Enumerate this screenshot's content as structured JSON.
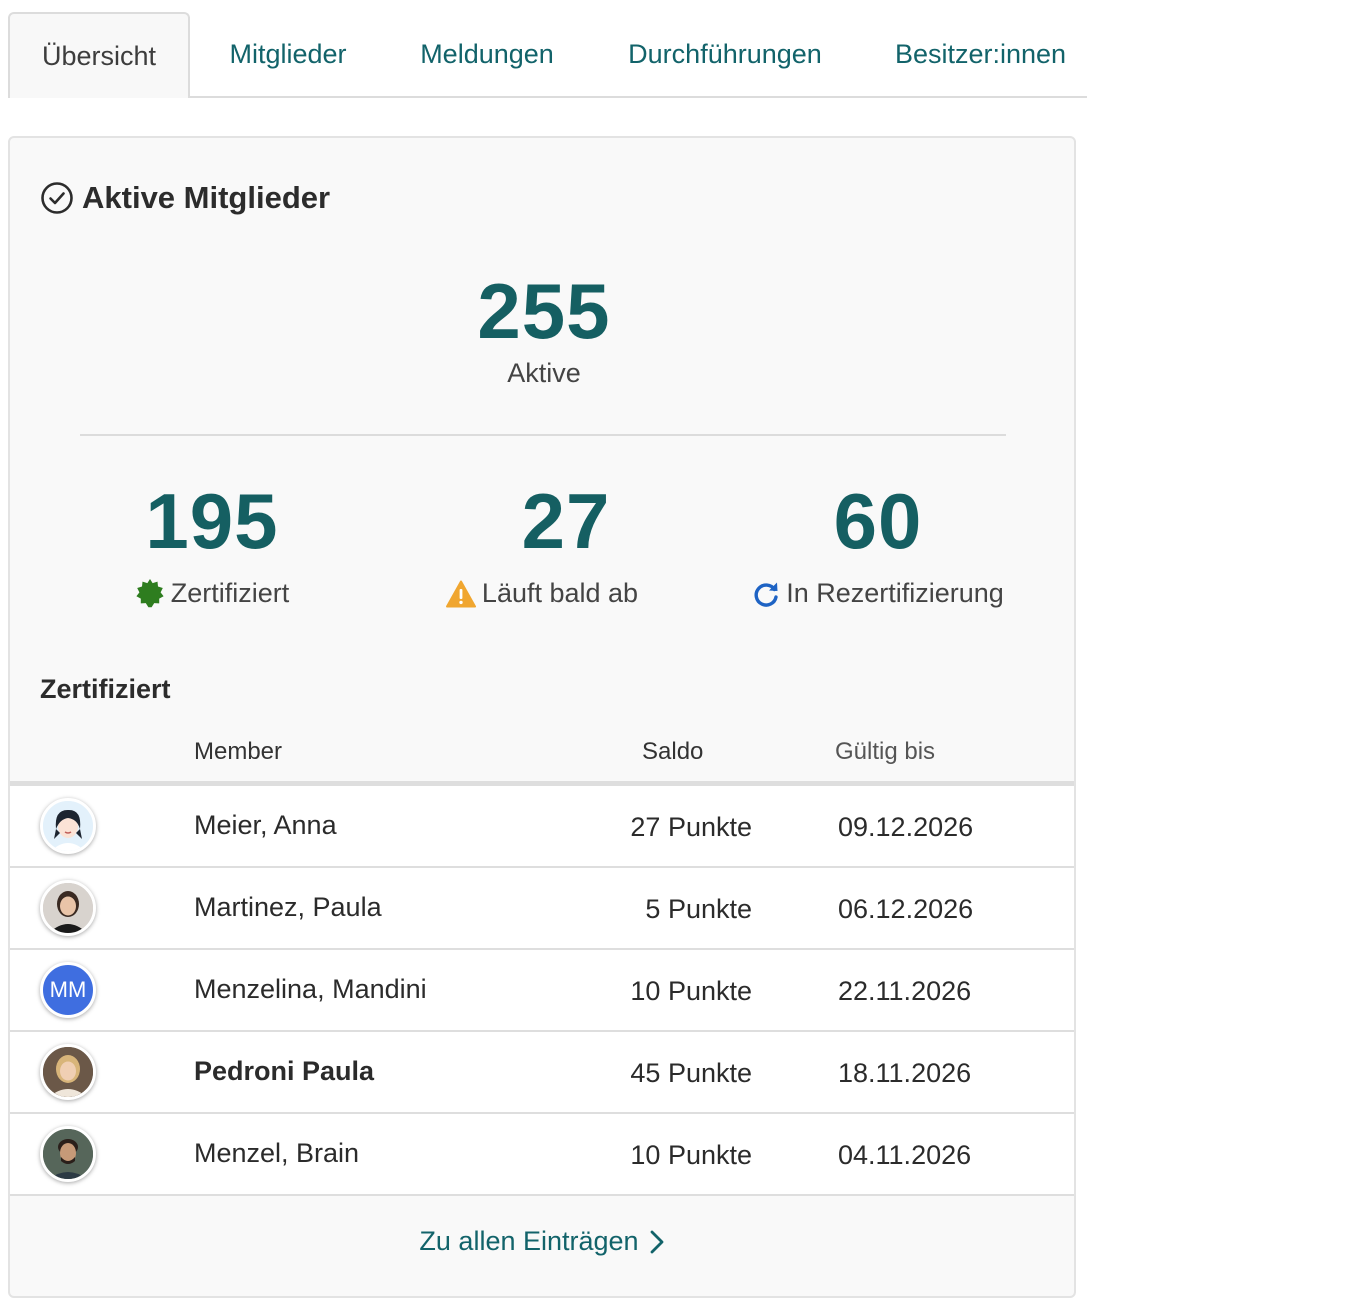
{
  "tabs": [
    {
      "label": "Übersicht"
    },
    {
      "label": "Mitglieder"
    },
    {
      "label": "Meldungen"
    },
    {
      "label": "Durchführungen"
    },
    {
      "label": "Besitzer:innen"
    }
  ],
  "card": {
    "title": "Aktive Mitglieder",
    "total": {
      "value": "255",
      "label": "Aktive"
    },
    "stats": [
      {
        "value": "195",
        "label": "Zertifiziert",
        "icon": "certified-badge-icon",
        "color": "#2e7d1f"
      },
      {
        "value": "27",
        "label": "Läuft bald ab",
        "icon": "warning-icon",
        "color": "#f0a630"
      },
      {
        "value": "60",
        "label": "In Rezertifizierung",
        "icon": "refresh-icon",
        "color": "#1e63c4"
      }
    ]
  },
  "section": {
    "title": "Zertifiziert"
  },
  "table": {
    "headers": {
      "member": "Member",
      "saldo": "Saldo",
      "valid": "Gültig bis"
    },
    "rows": [
      {
        "name": "Meier, Anna",
        "saldo": "27 Punkte",
        "valid": "09.12.2026",
        "avatar": "illustrated-avatar"
      },
      {
        "name": "Martinez, Paula",
        "saldo": "5 Punkte",
        "valid": "06.12.2026",
        "avatar": "photo-avatar"
      },
      {
        "name": "Menzelina, Mandini",
        "saldo": "10 Punkte",
        "valid": "22.11.2026",
        "avatar": "initials-avatar",
        "initials": "MM"
      },
      {
        "name": "Pedroni Paula",
        "saldo": "45 Punkte",
        "valid": "18.11.2026",
        "avatar": "photo-avatar"
      },
      {
        "name": "Menzel, Brain",
        "saldo": "10 Punkte",
        "valid": "04.11.2026",
        "avatar": "photo-avatar"
      }
    ]
  },
  "footer": {
    "link_label": "Zu allen Einträgen"
  },
  "colors": {
    "accent": "#155f62",
    "link": "#12636a",
    "initials_bg": "#3f6ee0"
  }
}
